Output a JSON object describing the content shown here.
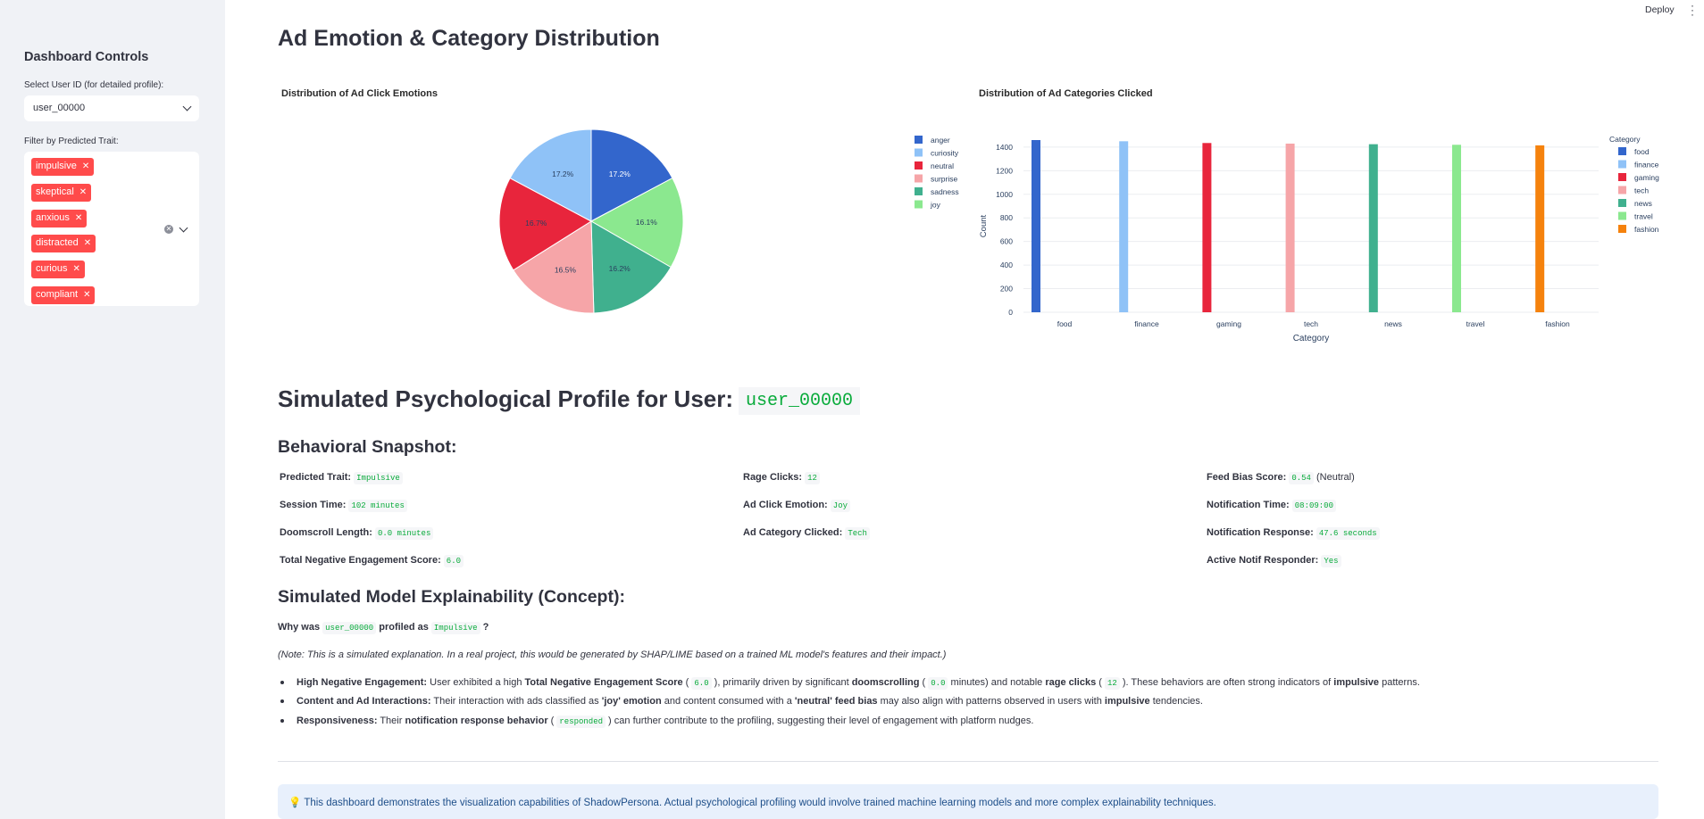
{
  "header": {
    "deploy_label": "Deploy"
  },
  "sidebar": {
    "title": "Dashboard Controls",
    "user_select_label": "Select User ID (for detailed profile):",
    "user_select_value": "user_00000",
    "trait_filter_label": "Filter by Predicted Trait:",
    "trait_tags": [
      "impulsive",
      "skeptical",
      "anxious",
      "distracted",
      "curious",
      "compliant"
    ]
  },
  "main": {
    "title": "Ad Emotion & Category Distribution",
    "profile_heading": "Simulated Psychological Profile for User:",
    "profile_user": "user_00000",
    "snapshot_heading": "Behavioral Snapshot:",
    "snapshot": {
      "predicted_trait": {
        "label": "Predicted Trait:",
        "value": "Impulsive"
      },
      "session_time": {
        "label": "Session Time:",
        "value": "102 minutes"
      },
      "doomscroll": {
        "label": "Doomscroll Length:",
        "value": "0.0 minutes"
      },
      "neg_score": {
        "label": "Total Negative Engagement Score:",
        "value": "6.0"
      },
      "rage_clicks": {
        "label": "Rage Clicks:",
        "value": "12"
      },
      "ad_emotion": {
        "label": "Ad Click Emotion:",
        "value": "Joy"
      },
      "ad_category": {
        "label": "Ad Category Clicked:",
        "value": "Tech"
      },
      "feed_bias": {
        "label": "Feed Bias Score:",
        "value": "0.54",
        "suffix": "(Neutral)"
      },
      "notif_time": {
        "label": "Notification Time:",
        "value": "08:09:00"
      },
      "notif_response": {
        "label": "Notification Response:",
        "value": "47.6 seconds"
      },
      "active_notif": {
        "label": "Active Notif Responder:",
        "value": "Yes"
      }
    },
    "explain_heading": "Simulated Model Explainability (Concept):",
    "why": {
      "pre": "Why was",
      "user": "user_00000",
      "mid": "profiled as",
      "trait": "Impulsive",
      "post": "?"
    },
    "note": "(Note: This is a simulated explanation. In a real project, this would be generated by SHAP/LIME based on a trained ML model's features and their impact.)",
    "bullets": {
      "b1": {
        "t1": "High Negative Engagement:",
        "t2": " User exhibited a high ",
        "t3": "Total Negative Engagement Score",
        "t4": " ( ",
        "c1": "6.0",
        "t5": " ), primarily driven by significant ",
        "t6": "doomscrolling",
        "t7": " ( ",
        "c2": "0.0",
        "t8": " minutes) and notable ",
        "t9": "rage clicks",
        "t10": " ( ",
        "c3": "12",
        "t11": " ). These behaviors are often strong indicators of ",
        "t12": "impulsive",
        "t13": " patterns."
      },
      "b2": {
        "t1": "Content and Ad Interactions:",
        "t2": " Their interaction with ads classified as ",
        "t3": "'joy' emotion",
        "t4": " and content consumed with a ",
        "t5": "'neutral' feed bias",
        "t6": " may also align with patterns observed in users with ",
        "t7": "impulsive",
        "t8": " tendencies."
      },
      "b3": {
        "t1": "Responsiveness:",
        "t2": " Their ",
        "t3": "notification response behavior",
        "t4": " ( ",
        "c1": "responded",
        "t5": " ) can further contribute to the profiling, suggesting their level of engagement with platform nudges."
      }
    },
    "info_icon": "lightbulb-icon",
    "info_icon_glyph": "💡",
    "info_text": "This dashboard demonstrates the visualization capabilities of ShadowPersona. Actual psychological profiling would involve trained machine learning models and more complex explainability techniques."
  },
  "chart_data": [
    {
      "type": "pie",
      "title": "Distribution of Ad Click Emotions",
      "categories": [
        "anger",
        "curiosity",
        "neutral",
        "surprise",
        "sadness",
        "joy"
      ],
      "values": [
        17.2,
        17.2,
        16.7,
        16.5,
        16.2,
        16.1
      ],
      "labels": [
        "17.2%",
        "17.2%",
        "16.7%",
        "16.5%",
        "16.2%",
        "16.1%"
      ],
      "colors": [
        "#3366cc",
        "#8fc2f7",
        "#e8253c",
        "#f6a5a8",
        "#40b08e",
        "#8be88f"
      ],
      "slice_order": [
        "anger",
        "joy",
        "sadness",
        "surprise",
        "neutral",
        "curiosity"
      ],
      "legend_position": "right"
    },
    {
      "type": "bar",
      "title": "Distribution of Ad Categories Clicked",
      "xlabel": "Category",
      "ylabel": "Count",
      "legend_title": "Category",
      "categories": [
        "food",
        "finance",
        "gaming",
        "tech",
        "news",
        "travel",
        "fashion"
      ],
      "values": [
        1460,
        1450,
        1435,
        1430,
        1425,
        1420,
        1415
      ],
      "colors": [
        "#3366cc",
        "#8fc2f7",
        "#e8253c",
        "#f6a5a8",
        "#40b08e",
        "#8be88f",
        "#f5820d"
      ],
      "yticks": [
        0,
        200,
        400,
        600,
        800,
        1000,
        1200,
        1400
      ],
      "ylim": [
        0,
        1460
      ],
      "grid": true,
      "legend_position": "right"
    }
  ]
}
